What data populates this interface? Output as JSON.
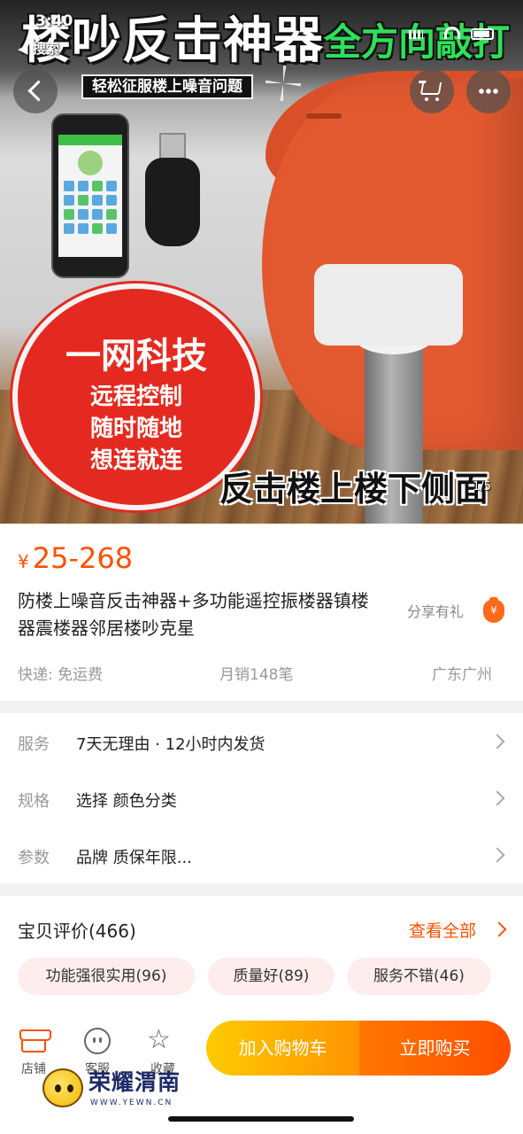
{
  "status_bar": {
    "time": "3:40",
    "back_app": "◀ 搜索"
  },
  "hero": {
    "headline": "楼吵反击神器",
    "headline_green": "全方向敲打",
    "subline": "轻松征服楼上噪音问题",
    "badge_title": "一网科技",
    "badge_lines": [
      "远程控制",
      "随时随地",
      "想连就连"
    ],
    "bottom_caption": "反击楼上楼下侧面",
    "counter": "1/5"
  },
  "nav": {
    "back_icon": "chevron-left-icon",
    "cart_icon": "cart-icon",
    "more_icon": "more-dots-icon"
  },
  "product": {
    "price_symbol": "¥",
    "price": "25-268",
    "title": "防楼上噪音反击神器+多功能遥控振楼器镇楼器震楼器邻居楼吵克星",
    "share_label": "分享有礼",
    "share_icon_glyph": "¥",
    "shipping": "快递: 免运费",
    "monthly_sales": "月销148笔",
    "location": "广东广州"
  },
  "specs": [
    {
      "key": "服务",
      "value": "7天无理由 · 12小时内发货"
    },
    {
      "key": "规格",
      "value": "选择  颜色分类"
    },
    {
      "key": "参数",
      "value": "品牌 质保年限..."
    }
  ],
  "reviews": {
    "title": "宝贝评价(466)",
    "view_all": "查看全部",
    "tags": [
      "功能强很实用(96)",
      "质量好(89)",
      "服务不错(46)"
    ]
  },
  "bottom_bar": {
    "store": "店铺",
    "service": "客服",
    "favorite": "收藏",
    "favorite_glyph": "☆",
    "add_to_cart": "加入购物车",
    "buy_now": "立即购买"
  },
  "watermark": {
    "name": "荣耀渭南",
    "url": "WWW.YEWN.CN"
  },
  "colors": {
    "accent": "#ff5000",
    "cart_button": "#ffb400",
    "buy_button": "#ff5a00",
    "tag_bg": "#ffeded"
  }
}
